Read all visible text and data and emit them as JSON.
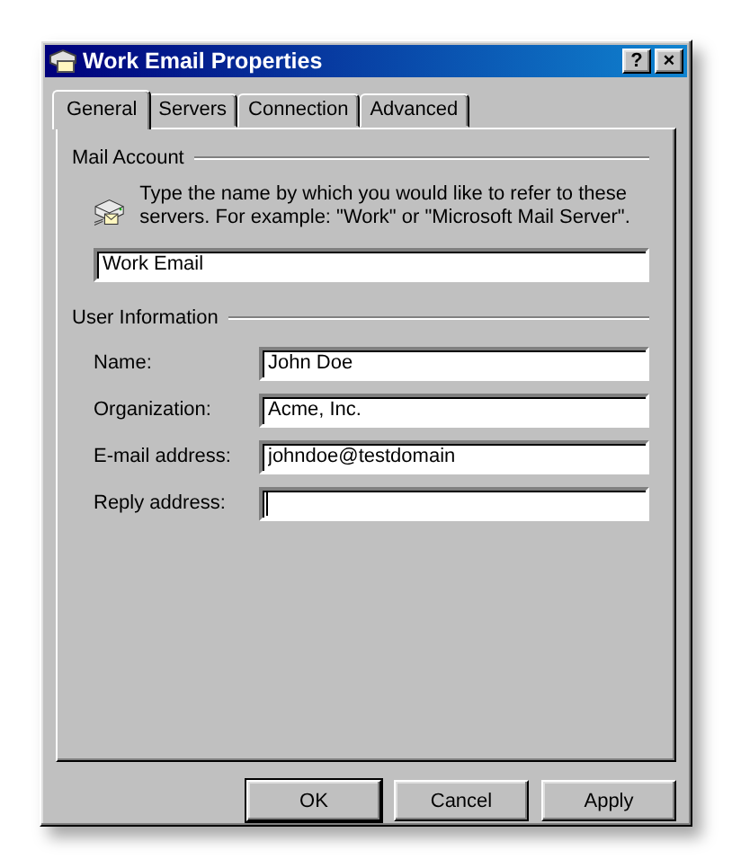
{
  "window": {
    "title": "Work Email Properties",
    "title_buttons": [
      "?",
      "×"
    ]
  },
  "tabs": [
    {
      "label": "General",
      "selected": true
    },
    {
      "label": "Servers",
      "selected": false
    },
    {
      "label": "Connection",
      "selected": false
    },
    {
      "label": "Advanced",
      "selected": false
    }
  ],
  "mail_account": {
    "heading": "Mail Account",
    "description": "Type the name by which you would like to refer to these servers.  For example: \"Work\" or \"Microsoft Mail Server\".",
    "value": "Work Email"
  },
  "user_information": {
    "heading": "User Information",
    "fields": [
      {
        "label": "Name:",
        "value": "John Doe",
        "focused": false
      },
      {
        "label": "Organization:",
        "value": "Acme, Inc.",
        "focused": false
      },
      {
        "label": "E-mail address:",
        "value": "johndoe@testdomain",
        "focused": false
      },
      {
        "label": "Reply address:",
        "focused": true
      }
    ]
  },
  "buttons": [
    {
      "label": "OK",
      "default": true
    },
    {
      "label": "Cancel",
      "default": false
    },
    {
      "label": "Apply",
      "default": false
    }
  ]
}
